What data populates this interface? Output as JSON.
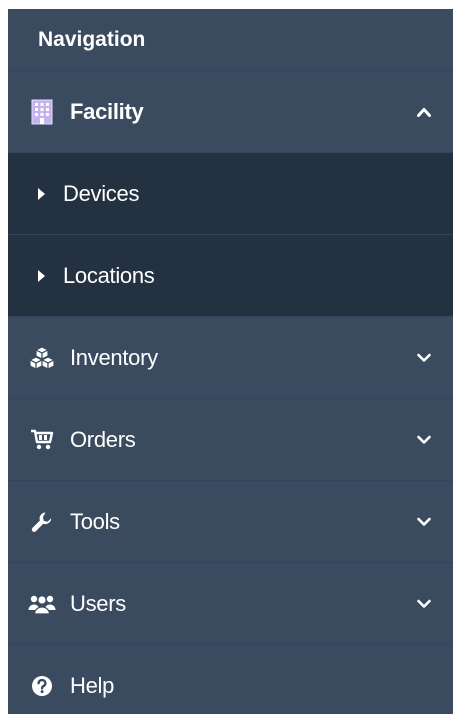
{
  "nav": {
    "header": "Navigation",
    "sections": [
      {
        "label": "Facility",
        "icon": "building-icon",
        "expanded": true,
        "children": [
          {
            "label": "Devices"
          },
          {
            "label": "Locations"
          }
        ]
      },
      {
        "label": "Inventory",
        "icon": "cubes-icon",
        "expanded": false
      },
      {
        "label": "Orders",
        "icon": "cart-icon",
        "expanded": false
      },
      {
        "label": "Tools",
        "icon": "wrench-icon",
        "expanded": false
      },
      {
        "label": "Users",
        "icon": "users-icon",
        "expanded": false
      },
      {
        "label": "Help",
        "icon": "question-circle-icon"
      }
    ]
  },
  "colors": {
    "sidebar_bg": "#3b4b5f",
    "submenu_bg": "#233141",
    "text": "#ffffff",
    "facility_icon": "#c5b3f0"
  }
}
